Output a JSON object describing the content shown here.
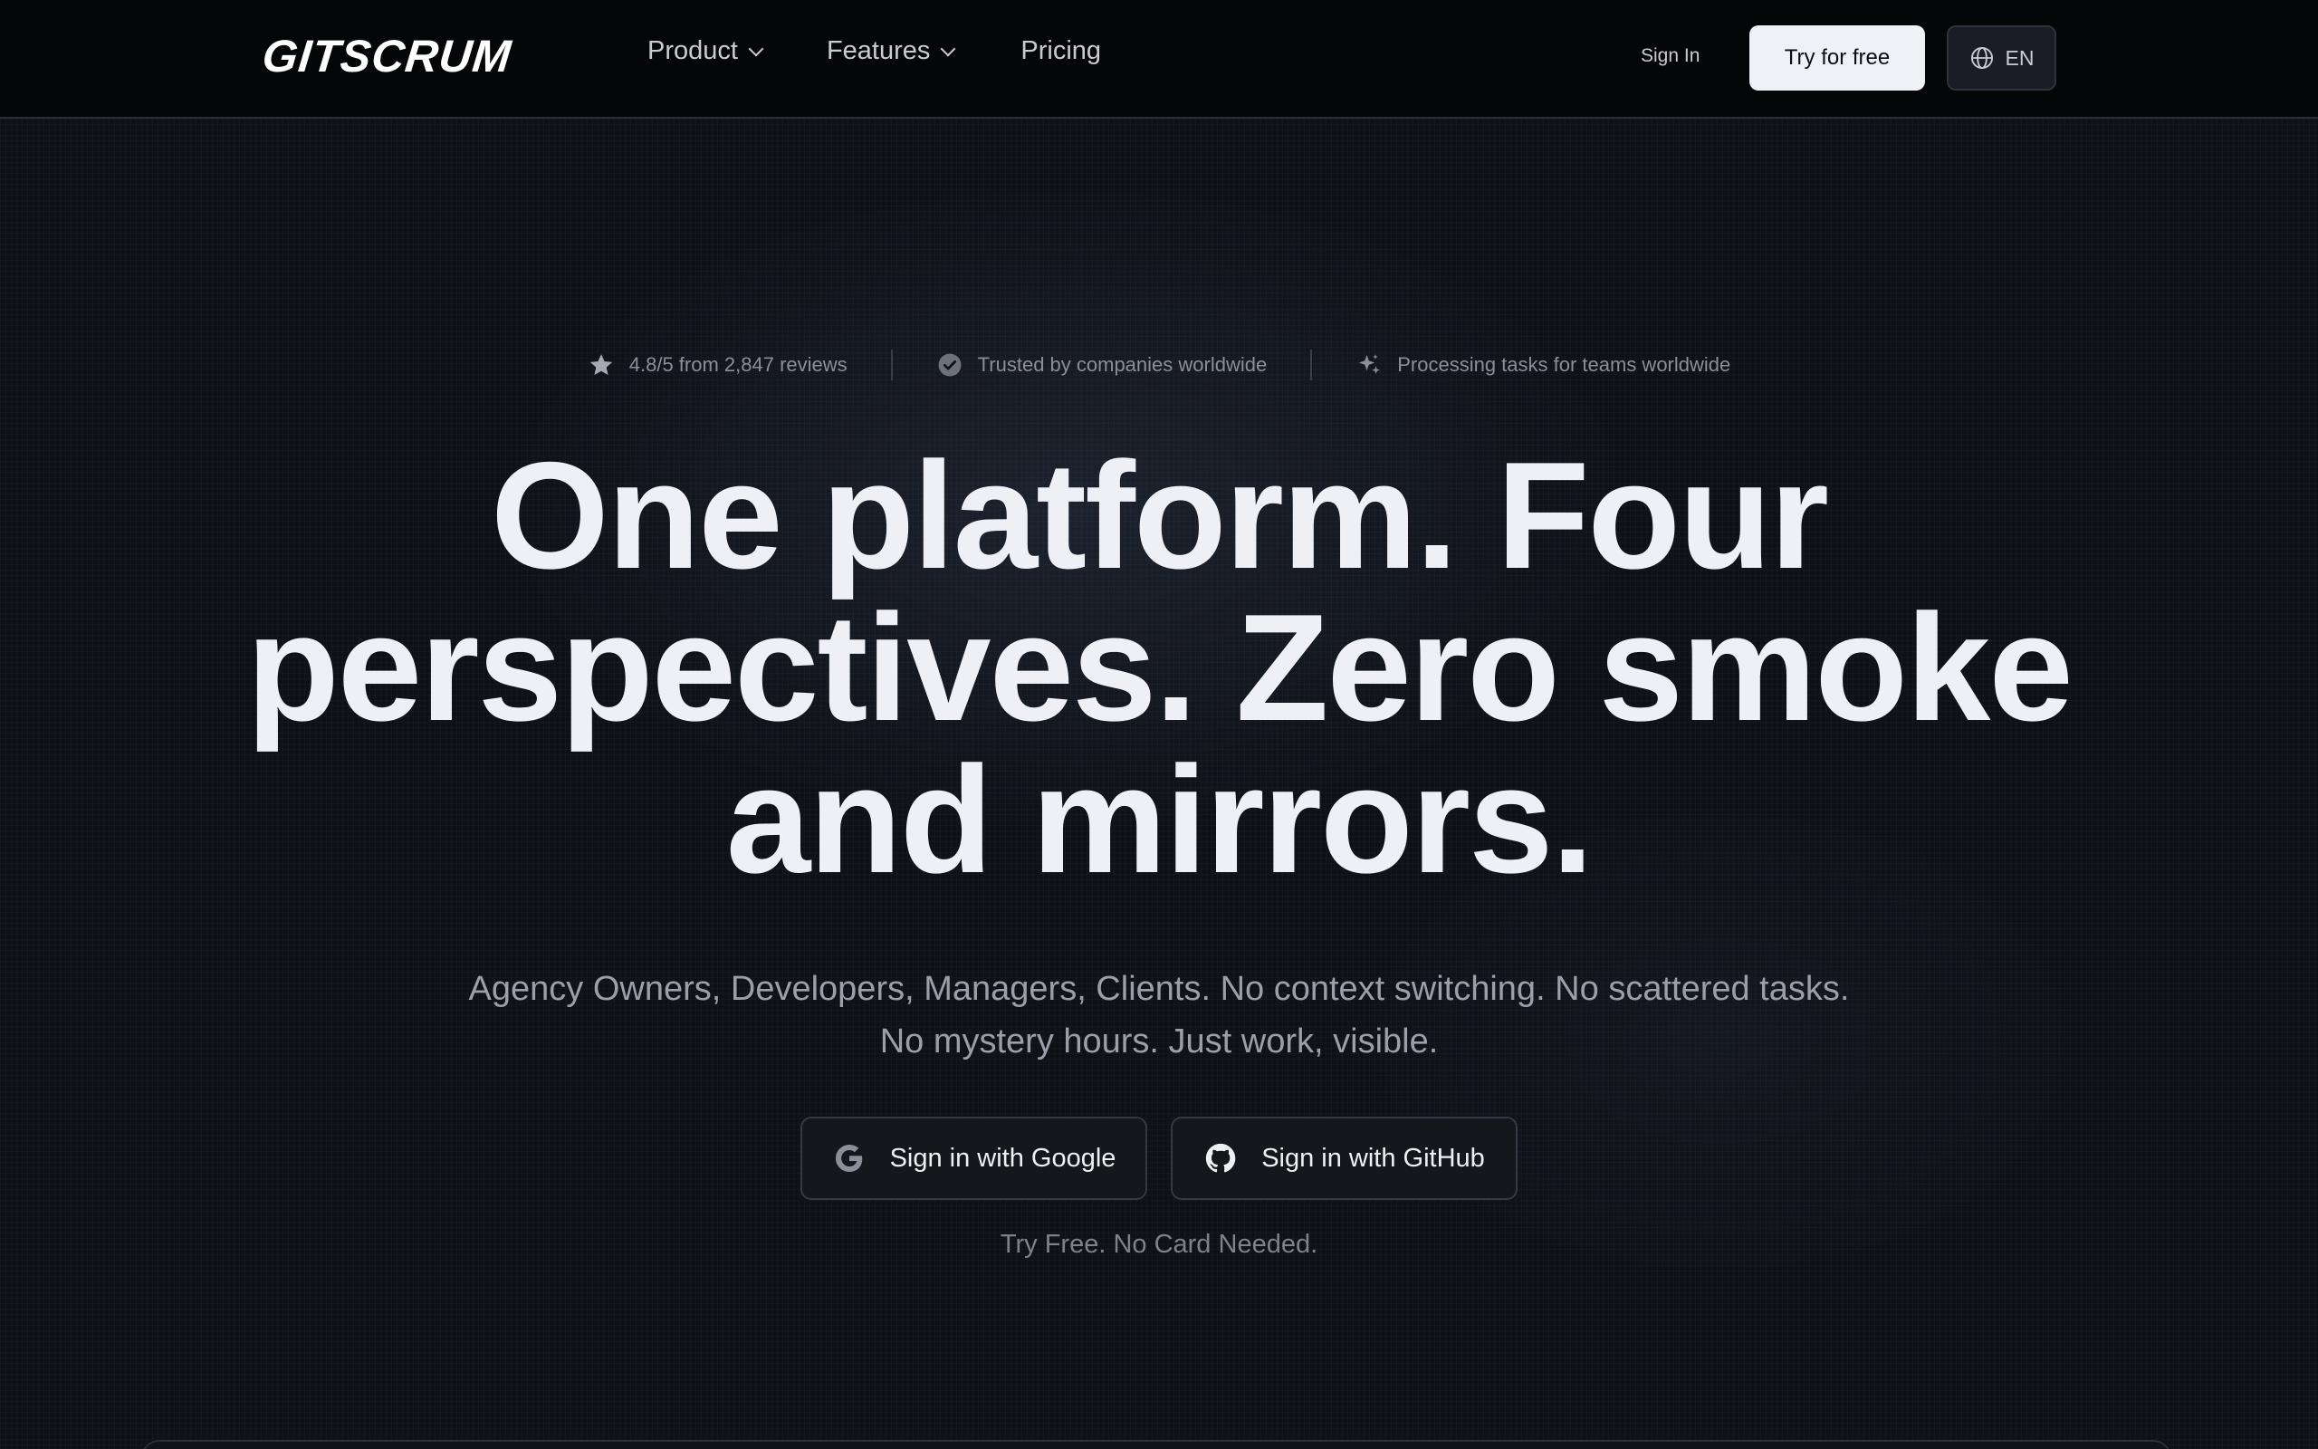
{
  "nav": {
    "logo": "GITSCRUM",
    "links": [
      {
        "label": "Product",
        "has_dropdown": true
      },
      {
        "label": "Features",
        "has_dropdown": true
      },
      {
        "label": "Pricing",
        "has_dropdown": false
      }
    ],
    "sign_in": "Sign In",
    "try_free": "Try for free",
    "language": "EN",
    "language_icon": "globe-icon"
  },
  "stats": [
    {
      "icon": "star-icon",
      "text": "4.8/5 from 2,847 reviews"
    },
    {
      "icon": "check-badge-icon",
      "text": "Trusted by companies worldwide"
    },
    {
      "icon": "sparkle-icon",
      "text": "Processing tasks for teams worldwide"
    }
  ],
  "hero": {
    "headline_lines": [
      "One platform. Four",
      "perspectives. Zero smoke",
      "and mirrors."
    ],
    "subhead_lines": [
      "Agency Owners, Developers, Managers, Clients. No context switching. No scattered tasks.",
      "No mystery hours. Just work, visible."
    ],
    "google_button": "Sign in with Google",
    "github_button": "Sign in with GitHub",
    "note": "Try Free. No Card Needed."
  },
  "colors": {
    "background": "#0e1116",
    "nav_background": "#050607",
    "primary_button": "#eef1f6",
    "text_primary": "#eef0f5",
    "text_muted": "#9a9fa8"
  }
}
